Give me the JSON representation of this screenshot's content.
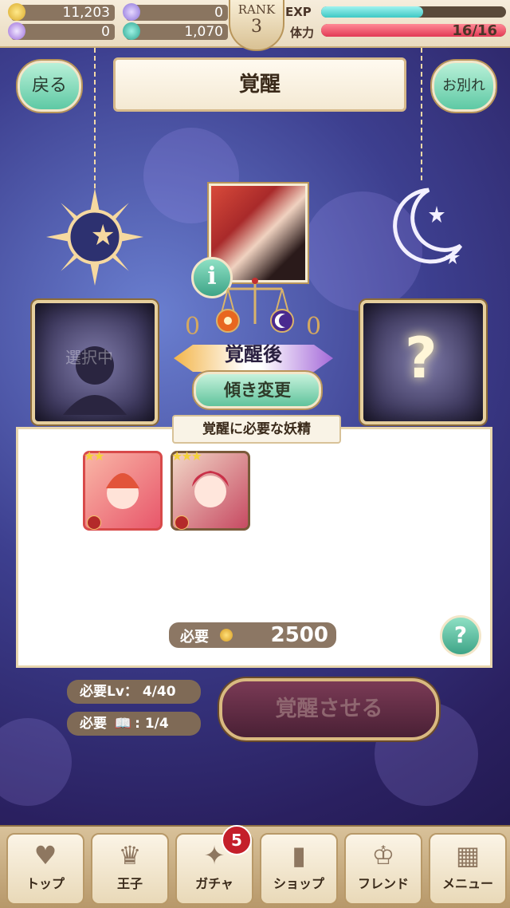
{
  "status": {
    "gold": "11,203",
    "item2": "0",
    "gems": "0",
    "fairy_points": "1,070",
    "rank_label": "RANK",
    "rank": "3",
    "exp_label": "EXP",
    "exp_fill": 0.55,
    "hp_label": "体力",
    "hp_text": "16/16",
    "hp_fill": 1.0
  },
  "header": {
    "back_label": "戻る",
    "title": "覚醒",
    "farewell_label": "お別れ"
  },
  "awakening": {
    "left_count": "0",
    "right_count": "0",
    "selecting_text": "選択中",
    "left_card_symbol": "?",
    "right_card_symbol": "?",
    "after_label": "覚醒後",
    "change_label": "傾き変更",
    "info_symbol": "i"
  },
  "fairies": {
    "panel_title": "覚醒に必要な妖精",
    "items": [
      {
        "stars": "★★"
      },
      {
        "stars": "★★★"
      }
    ],
    "cost_label": "必要",
    "cost_value": "2500",
    "help_symbol": "?"
  },
  "requirements": {
    "level_text": "必要Lv：  4/40",
    "book_label": "必要",
    "book_value": "1/4",
    "awaken_button": "覚醒させる"
  },
  "nav": {
    "items": [
      {
        "label": "トップ",
        "icon": "heart-icon"
      },
      {
        "label": "王子",
        "icon": "crown-icon"
      },
      {
        "label": "ガチャ",
        "icon": "gacha-icon"
      },
      {
        "label": "ショップ",
        "icon": "shop-icon"
      },
      {
        "label": "フレンド",
        "icon": "tiara-icon"
      },
      {
        "label": "メニュー",
        "icon": "grid-icon"
      }
    ],
    "gacha_badge": "5"
  }
}
